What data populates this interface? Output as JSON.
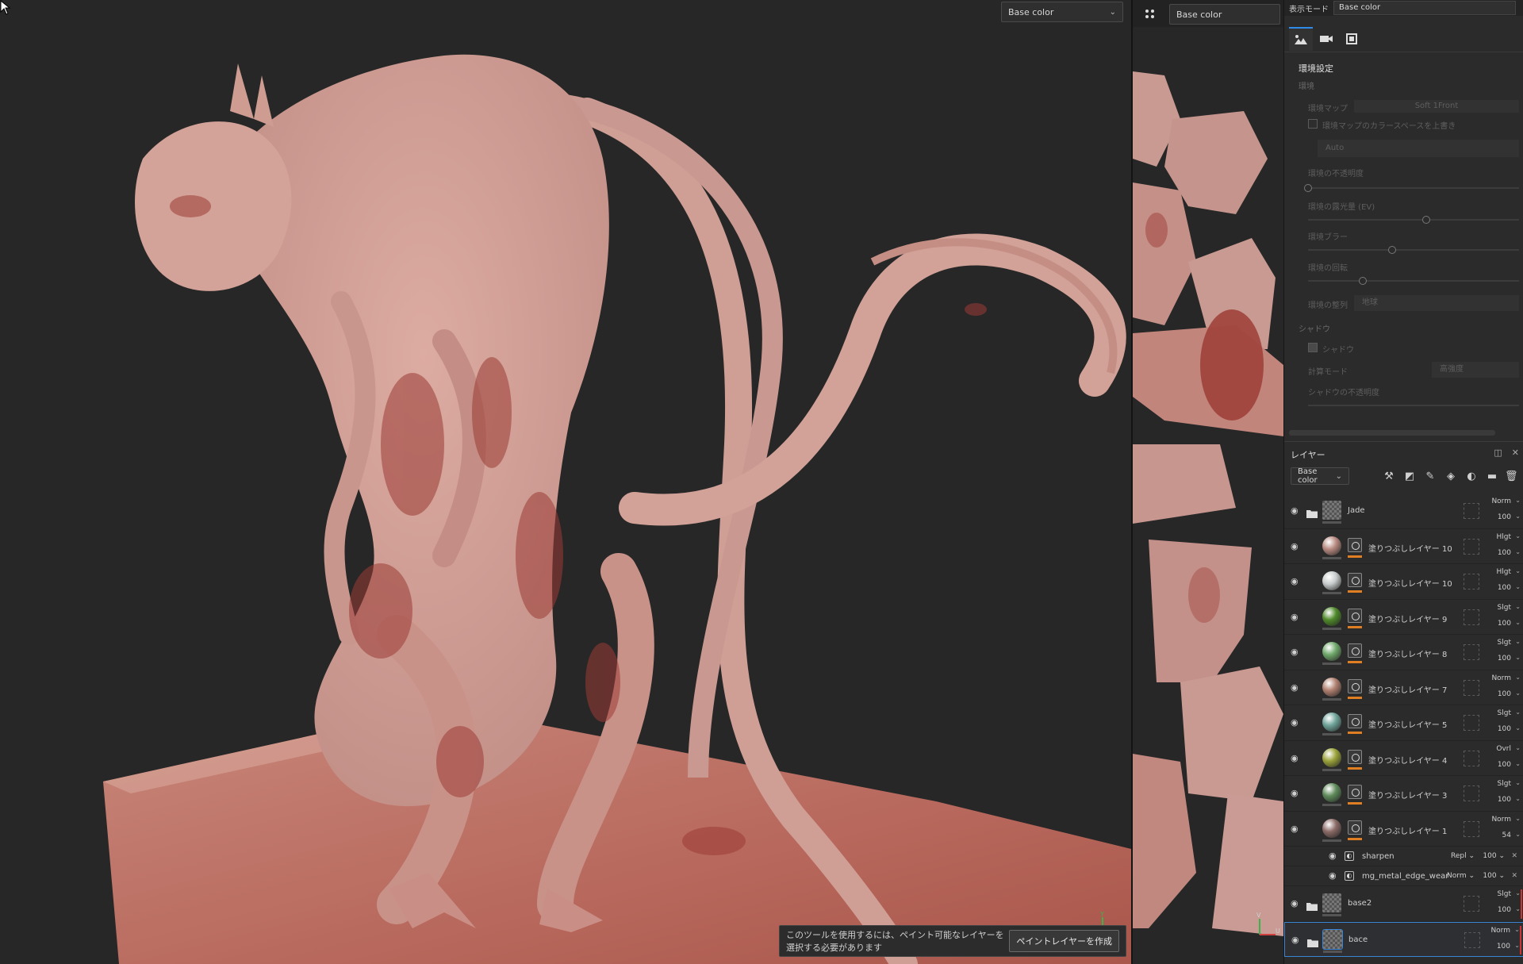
{
  "viewport": {
    "channel_dropdown": "Base color",
    "notice": {
      "message": "このツールを使用するには、ペイント可能なレイヤーを選択する必要があります",
      "button": "ペイントレイヤーを作成"
    },
    "gizmo_y": "Y"
  },
  "uv_view": {
    "channel_dropdown": "Base color",
    "gizmo_v": "V",
    "gizmo_u": "U"
  },
  "topbar": {
    "label": "表示モード",
    "dropdown": "Base color"
  },
  "environment": {
    "title": "環境設定",
    "section_env": "環境",
    "env_map_label": "環境マップ",
    "env_map_value": "Soft 1Front",
    "colorspace_override": "環境マップのカラースペースを上書き",
    "colorspace_value": "Auto",
    "opacity_label": "環境の不透明度",
    "opacity": 0.0,
    "exposure_label": "環境の露光量 (EV)",
    "exposure": 0.56,
    "blur_label": "環境ブラー",
    "blur": 0.4,
    "rotation_label": "環境の回転",
    "rotation": 0.26,
    "alignment_label": "環境の整列",
    "alignment_value": "地球",
    "section_shadow": "シャドウ",
    "shadow_checkbox": "シャドウ",
    "calc_mode_label": "計算モード",
    "calc_mode_value": "高強度",
    "shadow_opacity_label": "シャドウの不透明度"
  },
  "layers_panel": {
    "title": "レイヤー",
    "channel_dropdown": "Base color",
    "layers": [
      {
        "name": "Jade",
        "type": "folder",
        "blend": "Norm",
        "opacity": "100",
        "thumb_color": "#6a6a6a"
      },
      {
        "name": "塗りつぶしレイヤー 10",
        "type": "fill",
        "blend": "Hlgt",
        "opacity": "100",
        "thumb_color": "#b88a80"
      },
      {
        "name": "塗りつぶしレイヤー 10",
        "type": "fill",
        "blend": "Hlgt",
        "opacity": "100",
        "thumb_color": "#c8cccc"
      },
      {
        "name": "塗りつぶしレイヤー 9",
        "type": "fill",
        "blend": "Slgt",
        "opacity": "100",
        "thumb_color": "#4f8a2a"
      },
      {
        "name": "塗りつぶしレイヤー 8",
        "type": "fill",
        "blend": "Slgt",
        "opacity": "100",
        "thumb_color": "#6fa86a"
      },
      {
        "name": "塗りつぶしレイヤー 7",
        "type": "fill",
        "blend": "Norm",
        "opacity": "100",
        "thumb_color": "#b08070"
      },
      {
        "name": "塗りつぶしレイヤー 5",
        "type": "fill",
        "blend": "Slgt",
        "opacity": "100",
        "thumb_color": "#6fa49a"
      },
      {
        "name": "塗りつぶしレイヤー 4",
        "type": "fill",
        "blend": "Ovrl",
        "opacity": "100",
        "thumb_color": "#9aa23a"
      },
      {
        "name": "塗りつぶしレイヤー 3",
        "type": "fill",
        "blend": "Slgt",
        "opacity": "100",
        "thumb_color": "#5e8a5a"
      },
      {
        "name": "塗りつぶしレイヤー 1",
        "type": "fill",
        "blend": "Norm",
        "opacity": "54",
        "thumb_color": "#8a6a66"
      }
    ],
    "effects": [
      {
        "name": "sharpen",
        "blend": "Repl",
        "opacity": "100"
      },
      {
        "name": "mg_metal_edge_wear",
        "blend": "Norm",
        "opacity": "100"
      }
    ],
    "bottom_layers": [
      {
        "name": "base2",
        "type": "folder",
        "blend": "Slgt",
        "opacity": "100"
      },
      {
        "name": "bace",
        "type": "folder",
        "blend": "Norm",
        "opacity": "100",
        "selected": true
      }
    ]
  },
  "colors": {
    "accent": "#2f8be8",
    "orange_indicator": "#e07e22",
    "skin": "#d4a49a",
    "flesh_dark": "#9a3b34"
  }
}
